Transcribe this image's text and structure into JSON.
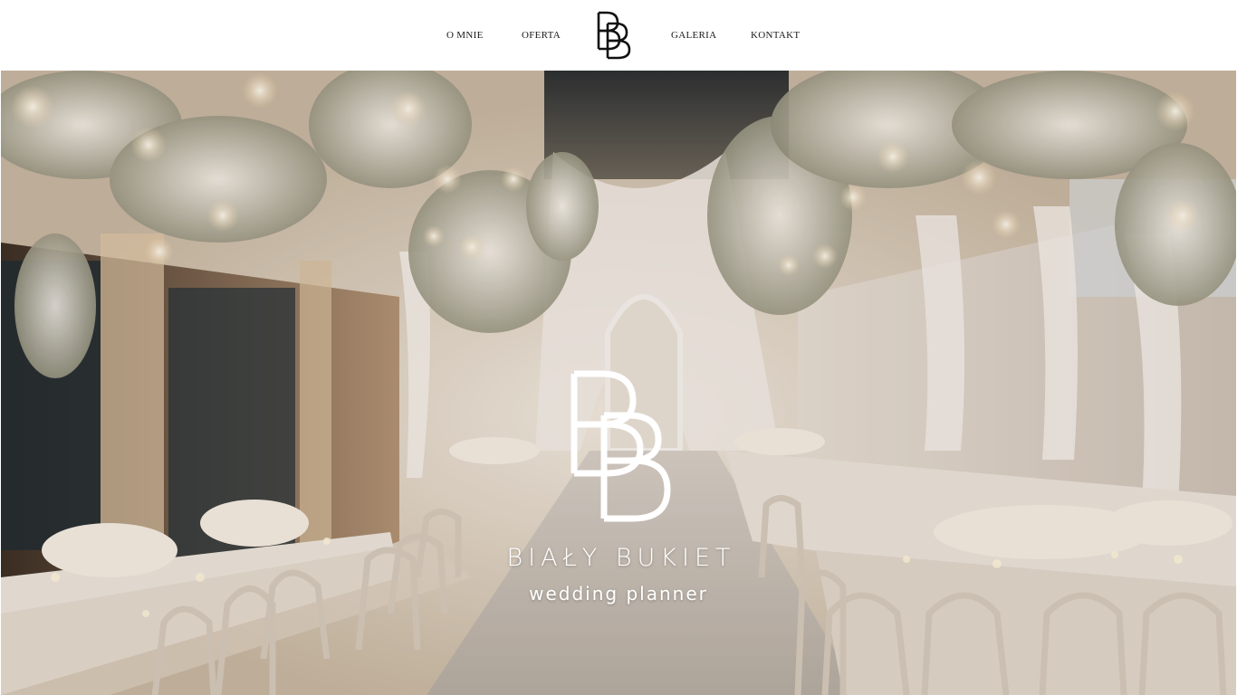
{
  "nav": {
    "left": [
      {
        "label": "O MNIE"
      },
      {
        "label": "OFERTA"
      }
    ],
    "right": [
      {
        "label": "GALERIA"
      },
      {
        "label": "KONTAKT"
      }
    ],
    "logo_icon": "bb-monogram-icon"
  },
  "hero": {
    "brand_name": "BIAŁY BUKIET",
    "tagline": "wedding planner",
    "logo_icon": "bb-monogram-icon"
  },
  "colors": {
    "header_bg": "#ffffff",
    "nav_text": "#1a1a1a",
    "hero_text": "#ffffff",
    "hero_tone": "#cdbba6"
  }
}
